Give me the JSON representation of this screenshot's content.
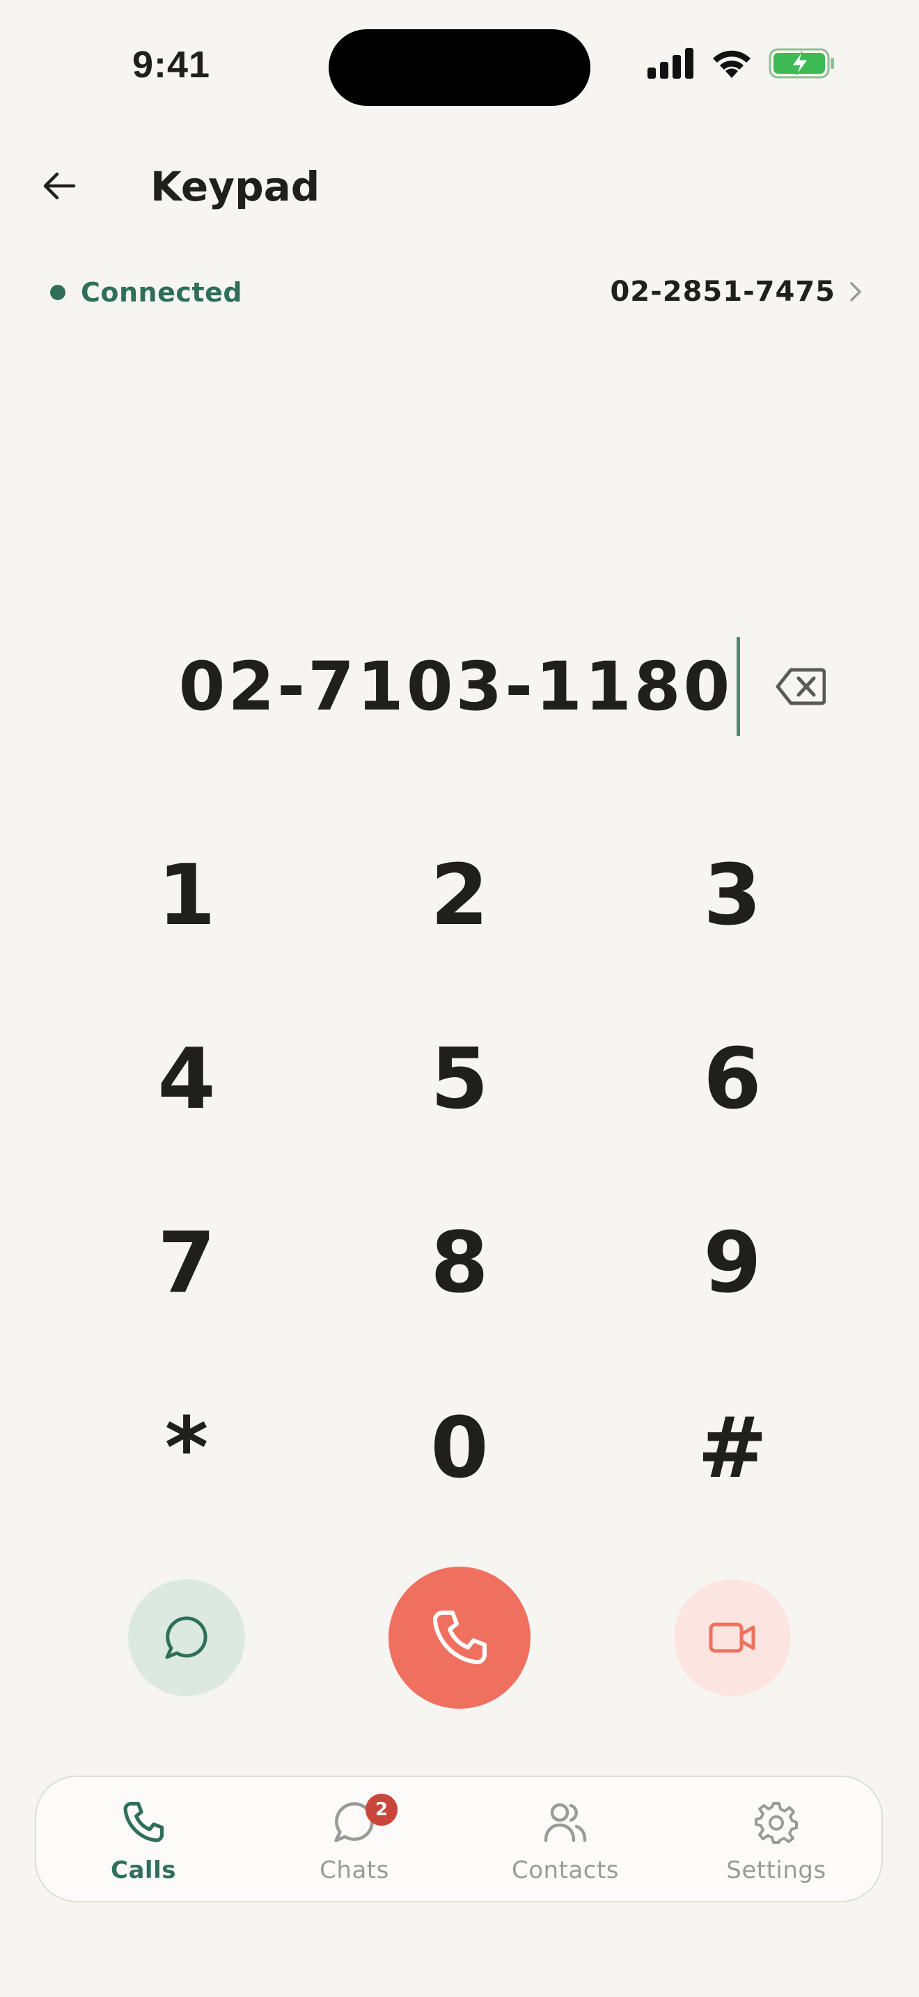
{
  "status_bar": {
    "time": "9:41"
  },
  "header": {
    "title": "Keypad"
  },
  "connection": {
    "status": "Connected",
    "line_number": "02-2851-7475"
  },
  "dialer": {
    "entered_number": "02-7103-1180"
  },
  "keypad": {
    "keys": [
      "1",
      "2",
      "3",
      "4",
      "5",
      "6",
      "7",
      "8",
      "9",
      "*",
      "0",
      "#"
    ]
  },
  "tabs": [
    {
      "label": "Calls",
      "icon": "phone-icon",
      "active": true
    },
    {
      "label": "Chats",
      "icon": "chat-icon",
      "badge": "2"
    },
    {
      "label": "Contacts",
      "icon": "contacts-icon"
    },
    {
      "label": "Settings",
      "icon": "gear-icon"
    }
  ],
  "colors": {
    "accent": "#2F6F5A",
    "call": "#F07060",
    "badge": "#C8473A",
    "background": "#F7F5F2"
  }
}
